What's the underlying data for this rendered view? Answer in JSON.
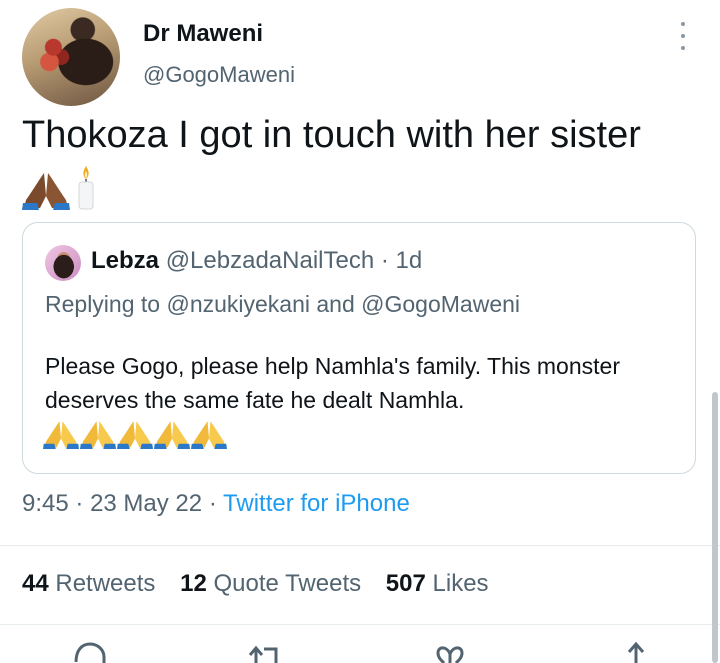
{
  "author": {
    "name": "Dr Maweni",
    "handle": "@GogoMaweni"
  },
  "tweet": {
    "text": "Thokoza I got in touch with her sister"
  },
  "quoted": {
    "name": "Lebza",
    "handle": "@LebzadaNailTech",
    "separator": "·",
    "time": "1d",
    "reply_prefix": "Replying to",
    "reply_user1": "@nzukiyekani",
    "reply_and": "and",
    "reply_user2": "@GogoMaweni",
    "text": "Please Gogo, please help Namhla's family. This monster deserves the same fate he dealt Namhla."
  },
  "meta": {
    "time": "9:45",
    "separator": "·",
    "date": "23 May 22",
    "source": "Twitter for iPhone"
  },
  "stats": {
    "retweets": {
      "count": "44",
      "label": "Retweets"
    },
    "quotes": {
      "count": "12",
      "label": "Quote Tweets"
    },
    "likes": {
      "count": "507",
      "label": "Likes"
    }
  },
  "icons": {
    "praying_hands": "praying-hands-emoji",
    "candle": "candle-emoji",
    "reply": "reply-icon",
    "retweet": "retweet-icon",
    "like": "heart-icon",
    "share": "share-icon",
    "more": "more-icon"
  },
  "colors": {
    "link": "#1d9bf0",
    "secondary_text": "#536471",
    "border": "#cfd9de"
  }
}
